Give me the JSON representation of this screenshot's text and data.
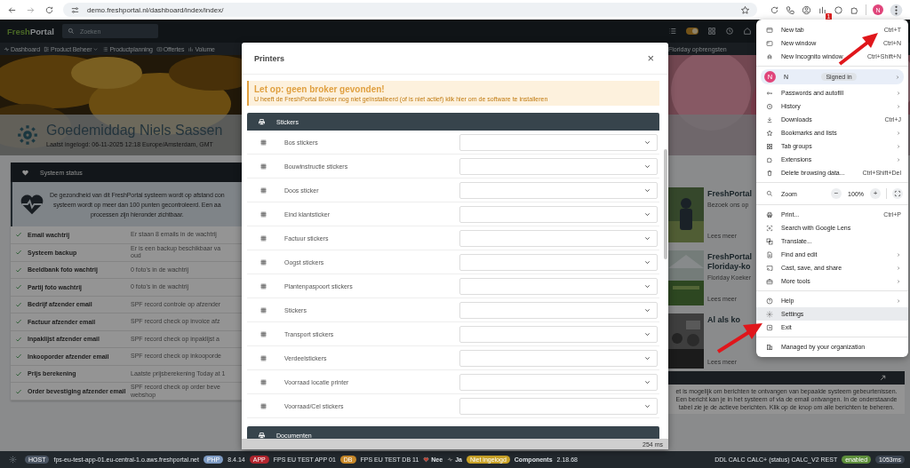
{
  "browser": {
    "url": "demo.freshportal.nl/dashboard/index/index/",
    "extension_badge": "1",
    "avatar": "N"
  },
  "header": {
    "logo_parts": [
      "Fresh",
      "Portal"
    ],
    "search_placeholder": "Zoeken",
    "toggle_on": true
  },
  "nav": [
    {
      "label": "Dashboard",
      "dropdown": false
    },
    {
      "label": "Product Beheer",
      "dropdown": true
    },
    {
      "label": "Productplanning",
      "dropdown": false
    },
    {
      "label": "Offertes",
      "dropdown": false
    },
    {
      "label": "Volume",
      "dropdown": false
    }
  ],
  "nav_right": "Floriday opbrengsten",
  "greeting": {
    "title": "Goedemiddag Niels Sassen",
    "subtitle": "Laatst ingelogd: 06-11-2025 12:18 Europe/Amsterdam, GMT"
  },
  "status_panel": {
    "title": "Systeem status",
    "info_lines": [
      "De gezondheid van dit FreshPortal systeem wordt op afstand con",
      "systeem wordt op meer dan 100 punten gecontroleerd. Een aa",
      "processen zijn hieronder zichtbaar."
    ],
    "rows": [
      {
        "label": "Email wachtrij",
        "detail": [
          "Er staan 8 emails in de wachtrij"
        ],
        "ok": true
      },
      {
        "label": "Systeem backup",
        "detail": [
          "Er is een backup beschikbaar va",
          "oud"
        ],
        "ok": true
      },
      {
        "label": "Beeldbank foto wachtrij",
        "detail": [
          "0 foto's in de wachtrij"
        ],
        "ok": true
      },
      {
        "label": "Partij foto wachtrij",
        "detail": [
          "0 foto's in de wachtrij"
        ],
        "ok": true
      },
      {
        "label": "Bedrijf afzender email",
        "detail": [
          "SPF record controle op afzender"
        ],
        "ok": true
      },
      {
        "label": "Factuur afzender email",
        "detail": [
          "SPF record check op invoice afz"
        ],
        "ok": true
      },
      {
        "label": "Inpaklijst afzender email",
        "detail": [
          "SPF record check op inpaklijst a"
        ],
        "ok": true
      },
      {
        "label": "Inkooporder afzender email",
        "detail": [
          "SPF record check op inkooporde"
        ],
        "ok": true
      },
      {
        "label": "Prijs berekening",
        "detail": [
          "Laatste prijsberekening Today at 1"
        ],
        "ok": true
      },
      {
        "label": "Order bevestiging afzender email",
        "detail": [
          "SPF record check op order beve",
          "webshop"
        ],
        "ok": true
      }
    ]
  },
  "cards": [
    {
      "title": "FreshPortal",
      "text": "Bezoek ons op",
      "link": "Lees meer"
    },
    {
      "title": "FreshPortal Floriday-ko",
      "text": "Floriday Koeker",
      "link": "Lees meer"
    },
    {
      "title": "Al als ko",
      "link": "Lees meer"
    }
  ],
  "messages_panel": {
    "text": "et is mogelijk om berichten te ontvangen van bepaalde systeem gebeurtenissen. Een bericht kan je in het systeem of via de email ontvangen. In de onderstaande tabel zie je de actieve berichten. Klik op de knop om alle berichten te beheren."
  },
  "modal": {
    "title": "Printers",
    "close": "×",
    "alert": {
      "title": "Let op: geen broker gevonden!",
      "text": "U heeft de FreshPortal Broker nog niet geïnstalleerd (of is niet actief) klik hier om de software te installeren"
    },
    "sections": [
      {
        "title": "Stickers",
        "rows": [
          "Bos stickers",
          "Bouwinstructie stickers",
          "Doos sticker",
          "Eind klantsticker",
          "Factuur stickers",
          "Oogst stickers",
          "Plantenpaspoort stickers",
          "Stickers",
          "Transport stickers",
          "Verdeelstickers",
          "Voorraad locatie printer",
          "Voorraad/Cel stickers"
        ]
      },
      {
        "title": "Documenten"
      }
    ],
    "timing": "254 ms"
  },
  "chrome_menu": {
    "groups": [
      [
        {
          "kind": "item",
          "label": "New tab",
          "shortcut": "Ctrl+T",
          "submenu": false,
          "highlighted": false
        },
        {
          "kind": "item",
          "label": "New window",
          "shortcut": "Ctrl+N",
          "submenu": false,
          "highlighted": false
        },
        {
          "kind": "item",
          "label": "New Incognito window",
          "shortcut": "Ctrl+Shift+N",
          "submenu": false,
          "highlighted": false
        }
      ],
      [
        {
          "kind": "profile",
          "avatar": "N",
          "label": "N",
          "status": "Signed in",
          "submenu": true,
          "highlighted": false
        },
        {
          "kind": "item",
          "label": "Passwords and autofill",
          "submenu": true,
          "highlighted": false
        },
        {
          "kind": "item",
          "label": "History",
          "submenu": true,
          "highlighted": false
        },
        {
          "kind": "item",
          "label": "Downloads",
          "shortcut": "Ctrl+J",
          "submenu": false,
          "highlighted": false
        },
        {
          "kind": "item",
          "label": "Bookmarks and lists",
          "submenu": true,
          "highlighted": false
        },
        {
          "kind": "item",
          "label": "Tab groups",
          "submenu": true,
          "highlighted": false
        },
        {
          "kind": "item",
          "label": "Extensions",
          "submenu": true,
          "highlighted": false
        },
        {
          "kind": "item",
          "label": "Delete browsing data...",
          "shortcut": "Ctrl+Shift+Del",
          "submenu": false,
          "highlighted": false
        }
      ],
      [
        {
          "kind": "zoom",
          "label": "Zoom",
          "minus": "−",
          "value": "100%",
          "plus": "+"
        }
      ],
      [
        {
          "kind": "item",
          "label": "Print...",
          "shortcut": "Ctrl+P",
          "submenu": false,
          "highlighted": false
        },
        {
          "kind": "item",
          "label": "Search with Google Lens",
          "submenu": false,
          "highlighted": false
        },
        {
          "kind": "item",
          "label": "Translate...",
          "submenu": false,
          "highlighted": false
        },
        {
          "kind": "item",
          "label": "Find and edit",
          "submenu": true,
          "highlighted": false
        },
        {
          "kind": "item",
          "label": "Cast, save, and share",
          "submenu": true,
          "highlighted": false
        },
        {
          "kind": "item",
          "label": "More tools",
          "submenu": true,
          "highlighted": false
        }
      ],
      [
        {
          "kind": "item",
          "label": "Help",
          "submenu": true,
          "highlighted": false
        },
        {
          "kind": "item",
          "label": "Settings",
          "submenu": false,
          "highlighted": true
        },
        {
          "kind": "item",
          "label": "Exit",
          "submenu": false,
          "highlighted": false
        }
      ],
      [
        {
          "kind": "item",
          "label": "Managed by your organization",
          "submenu": false,
          "highlighted": false
        }
      ]
    ]
  },
  "status_bar": {
    "left": [
      {
        "kind": "badge",
        "text": "HOST",
        "color": "#4b5563"
      },
      {
        "kind": "text",
        "text": "fps-eu-test-app-01.eu-central-1.o.aws.freshportal.net"
      },
      {
        "kind": "badge",
        "text": "PHP",
        "color": "#7f9cc4"
      },
      {
        "kind": "text",
        "text": "8.4.14"
      },
      {
        "kind": "badge",
        "text": "APP",
        "color": "#b3262f"
      },
      {
        "kind": "text",
        "text": "FPS EU TEST APP 01"
      },
      {
        "kind": "badge",
        "text": "DB",
        "color": "#c98a2b"
      },
      {
        "kind": "text",
        "text": "FPS EU TEST DB 11"
      },
      {
        "kind": "heart",
        "text": "Nee"
      },
      {
        "kind": "pulse",
        "text": "Ja"
      },
      {
        "kind": "badge",
        "text": "Niet ingelogd",
        "color": "#c9a227"
      },
      {
        "kind": "strong",
        "text": "Components"
      },
      {
        "kind": "text",
        "text": "2.18.68"
      }
    ],
    "right": [
      {
        "kind": "text",
        "text": "DDL CALC CALC+ (status) CALC_V2 REST"
      },
      {
        "kind": "badge",
        "text": "enabled",
        "color": "#5e8f3c"
      },
      {
        "kind": "badge",
        "text": "1053ms",
        "color": "#3b4450"
      }
    ]
  }
}
